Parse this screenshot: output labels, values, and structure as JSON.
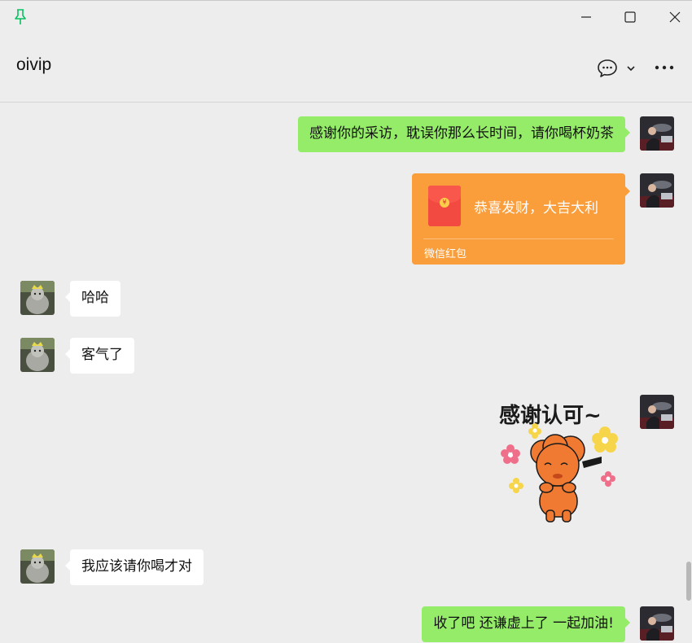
{
  "window": {
    "title": "oivip",
    "pin_icon": "pin-icon",
    "minimize_icon": "minimize-icon",
    "maximize_icon": "maximize-icon",
    "close_icon": "close-icon"
  },
  "header": {
    "chat_title": "oivip",
    "chat_icon": "chat-bubble-icon",
    "dropdown_icon": "chevron-down-icon",
    "more_icon": "more-dots-icon"
  },
  "messages": [
    {
      "side": "out",
      "type": "text",
      "text": "感谢你的采访，耽误你那么长时间，请你喝杯奶茶"
    },
    {
      "side": "out",
      "type": "red_packet",
      "greeting": "恭喜发财，大吉大利",
      "label": "微信红包"
    },
    {
      "side": "in",
      "type": "text",
      "text": "哈哈"
    },
    {
      "side": "in",
      "type": "text",
      "text": "客气了"
    },
    {
      "side": "out",
      "type": "sticker",
      "sticker_text": "感谢认可~"
    },
    {
      "side": "in",
      "type": "text",
      "text": "我应该请你喝才对"
    },
    {
      "side": "out",
      "type": "text",
      "text": "收了吧 还谦虚上了 一起加油!"
    }
  ],
  "colors": {
    "background": "#ededed",
    "outgoing_bubble": "#95ec69",
    "incoming_bubble": "#ffffff",
    "red_packet": "#fa9d3b",
    "pin_accent": "#07c160",
    "sticker_character": "#f07a32"
  }
}
